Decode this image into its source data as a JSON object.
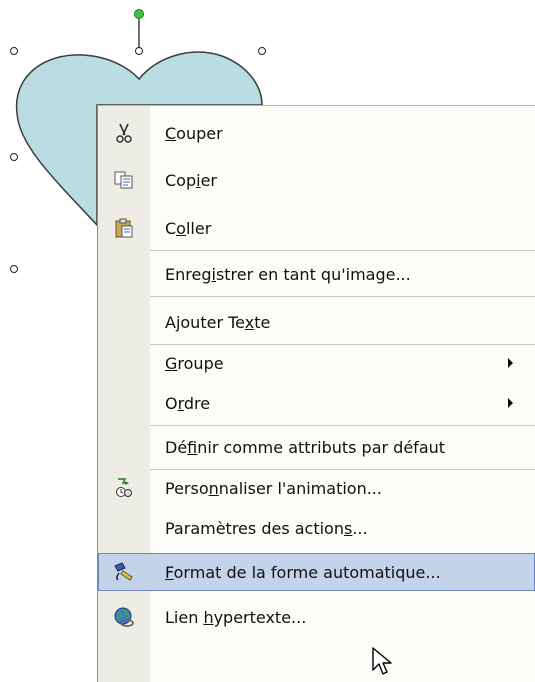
{
  "menu": {
    "items": [
      {
        "label": "Couper",
        "mnemonic_index": 0,
        "icon": "scissors-icon"
      },
      {
        "label": "Copier",
        "mnemonic_index": 3,
        "icon": "copy-icon"
      },
      {
        "label": "Coller",
        "mnemonic_index": 1,
        "icon": "paste-icon"
      },
      {
        "label": "Enregistrer en tant qu'image...",
        "mnemonic_index": 5,
        "icon": ""
      },
      {
        "label": "Ajouter Texte",
        "mnemonic_index": 10,
        "icon": ""
      },
      {
        "label": "Groupe",
        "mnemonic_index": 0,
        "icon": "",
        "submenu": true
      },
      {
        "label": "Ordre",
        "mnemonic_index": 1,
        "icon": "",
        "submenu": true
      },
      {
        "label": "Définir comme attributs par défaut",
        "mnemonic_index": 2,
        "icon": ""
      },
      {
        "label": "Personnaliser l'animation...",
        "mnemonic_index": 5,
        "icon": "animation-icon"
      },
      {
        "label": "Paramètres des actions...",
        "mnemonic_index": 21,
        "icon": ""
      },
      {
        "label": "Format de la forme automatique...",
        "mnemonic_index": 0,
        "icon": "format-brush-icon",
        "highlighted": true
      },
      {
        "label": "Lien hypertexte...",
        "mnemonic_index": 5,
        "icon": "hyperlink-globe-icon"
      }
    ]
  },
  "colors": {
    "heart_fill": "#b9dde2",
    "rotate_handle": "#3ec33e",
    "highlight": "#c3d3e9"
  }
}
